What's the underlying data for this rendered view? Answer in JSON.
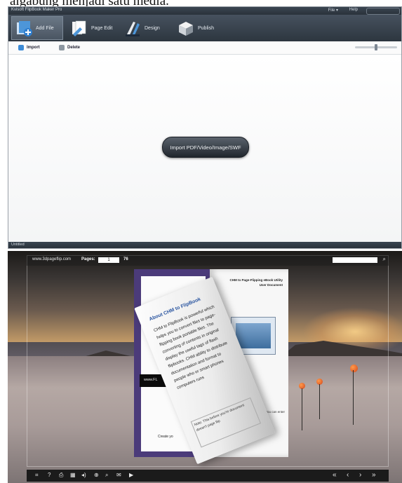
{
  "caption": "algabung menjadi satu media.",
  "app": {
    "title": "Kvisoft FlipBook Maker Pro",
    "menu_file": "File ▾",
    "menu_help": "Help",
    "tabs": [
      {
        "label": "Add File"
      },
      {
        "label": "Page Edit"
      },
      {
        "label": "Design"
      },
      {
        "label": "Publish"
      }
    ],
    "toolbar": {
      "import_label": "Import",
      "delete_label": "Delete"
    },
    "zoom_level": 0.5,
    "import_button_label": "Import PDF/Video/Image/SWF",
    "status_text": "Untitled",
    "colors": {
      "ribbon": "#2d363f",
      "accent": "#4a90d9"
    }
  },
  "viewer": {
    "site": "www.3dpageflip.com",
    "pages_label": "Pages:",
    "page_current": "1",
    "page_total": "76",
    "search_icon": "⌕",
    "page": {
      "curl_title": "About CHM to FlipBook",
      "curl_body": "CHM to FlipBook is powerful which helps you to convert files to page-flipping book portable files. The converting of contents in original display the useful tags of flash flipbooks. CHM ability to distribute documentation and format to people who or smart phones computers runs",
      "curl_note": "Note: This before you're document doesn't page flip",
      "right_head": "CHM to Page-Flipping eBook Utility User Document",
      "right_text": "using CHM to CHM Template You can enter",
      "cover_banner": "www.FL",
      "cover_footer": "Create yo"
    },
    "controls": [
      {
        "name": "fullscreen-icon",
        "glyph": "⌗"
      },
      {
        "name": "help-icon",
        "glyph": "?"
      },
      {
        "name": "print-icon",
        "glyph": "⎙"
      },
      {
        "name": "thumbnails-icon",
        "glyph": "▦"
      },
      {
        "name": "sound-icon",
        "glyph": "◂)"
      },
      {
        "name": "zoom-in-icon",
        "glyph": "⊕"
      },
      {
        "name": "search-icon",
        "glyph": "⌕"
      },
      {
        "name": "email-icon",
        "glyph": "✉"
      },
      {
        "name": "autoplay-icon",
        "glyph": "▶"
      }
    ],
    "nav": [
      {
        "name": "first-page-icon",
        "glyph": "«"
      },
      {
        "name": "previous-page-icon",
        "glyph": "‹"
      },
      {
        "name": "next-page-icon",
        "glyph": "›"
      },
      {
        "name": "last-page-icon",
        "glyph": "»"
      }
    ]
  }
}
